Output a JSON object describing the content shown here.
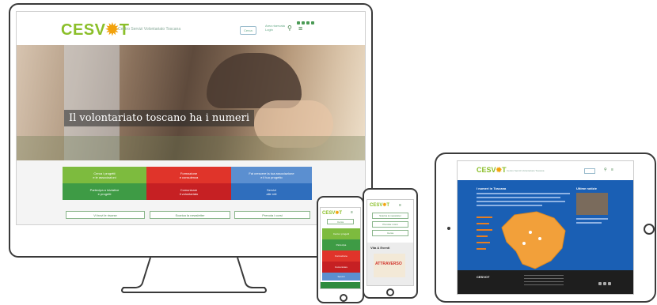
{
  "desktop": {
    "logo": {
      "prefix": "CESV",
      "suffix": "T"
    },
    "tagline": "Centro Servizi Volontariato Toscana",
    "header_button": "Cerca",
    "header_small": [
      "Area riservata",
      "Login"
    ],
    "hero_title": "Il volontariato toscano ha i numeri",
    "tiles": [
      {
        "label": "Cerca i progetti\ne le associazioni",
        "color": "#7dbb3e"
      },
      {
        "label": "Formazione\ne consulenza",
        "color": "#e0342a"
      },
      {
        "label": "Fai crescere la tua associazione\ne il tuo progetto",
        "color": "#5b8fd0"
      },
      {
        "label": "Partecipa a iniziative\ne progetti",
        "color": "#3e9b45"
      },
      {
        "label": "Comunicare\nil volontariato",
        "color": "#c62023"
      },
      {
        "label": "Servizi\nalle reti",
        "color": "#2f6ebd"
      }
    ],
    "buttons": [
      "Vi trovi le risorse",
      "Scarica la newsletter",
      "Prenota i corsi"
    ]
  },
  "phone_small": {
    "logo": {
      "prefix": "CESV",
      "suffix": "T"
    },
    "header_button": "Cerca",
    "tiles": [
      {
        "label": "Cerca i progetti",
        "color": "#7dbb3e"
      },
      {
        "label": "Partecipa",
        "color": "#3e9b45"
      },
      {
        "label": "Formazione",
        "color": "#e0342a"
      },
      {
        "label": "Comunicare",
        "color": "#c62023"
      },
      {
        "label": "Servizi",
        "color": "#5b8fd0"
      }
    ]
  },
  "phone_large": {
    "logo": {
      "prefix": "CESV",
      "suffix": "T"
    },
    "buttons": [
      "Scarica la newsletter",
      "Prenota i corsi",
      "Cerca"
    ],
    "section_title": "Vita & Eventi",
    "poster_text": "ATTRAVERSO"
  },
  "tablet": {
    "logo": {
      "prefix": "CESV",
      "suffix": "T"
    },
    "tagline": "Centro Servizi Volontariato Toscana",
    "section_title": "I numeri in Toscana",
    "side_title": "Ultime notizie",
    "footer_brand": "CESVOT",
    "map_color": "#f2a03a",
    "background": "#1a5fb4"
  },
  "colors": {
    "brand_green": "#8bbf2a",
    "brand_orange": "#f2a20d",
    "footer_dark": "#1e1e1e"
  }
}
